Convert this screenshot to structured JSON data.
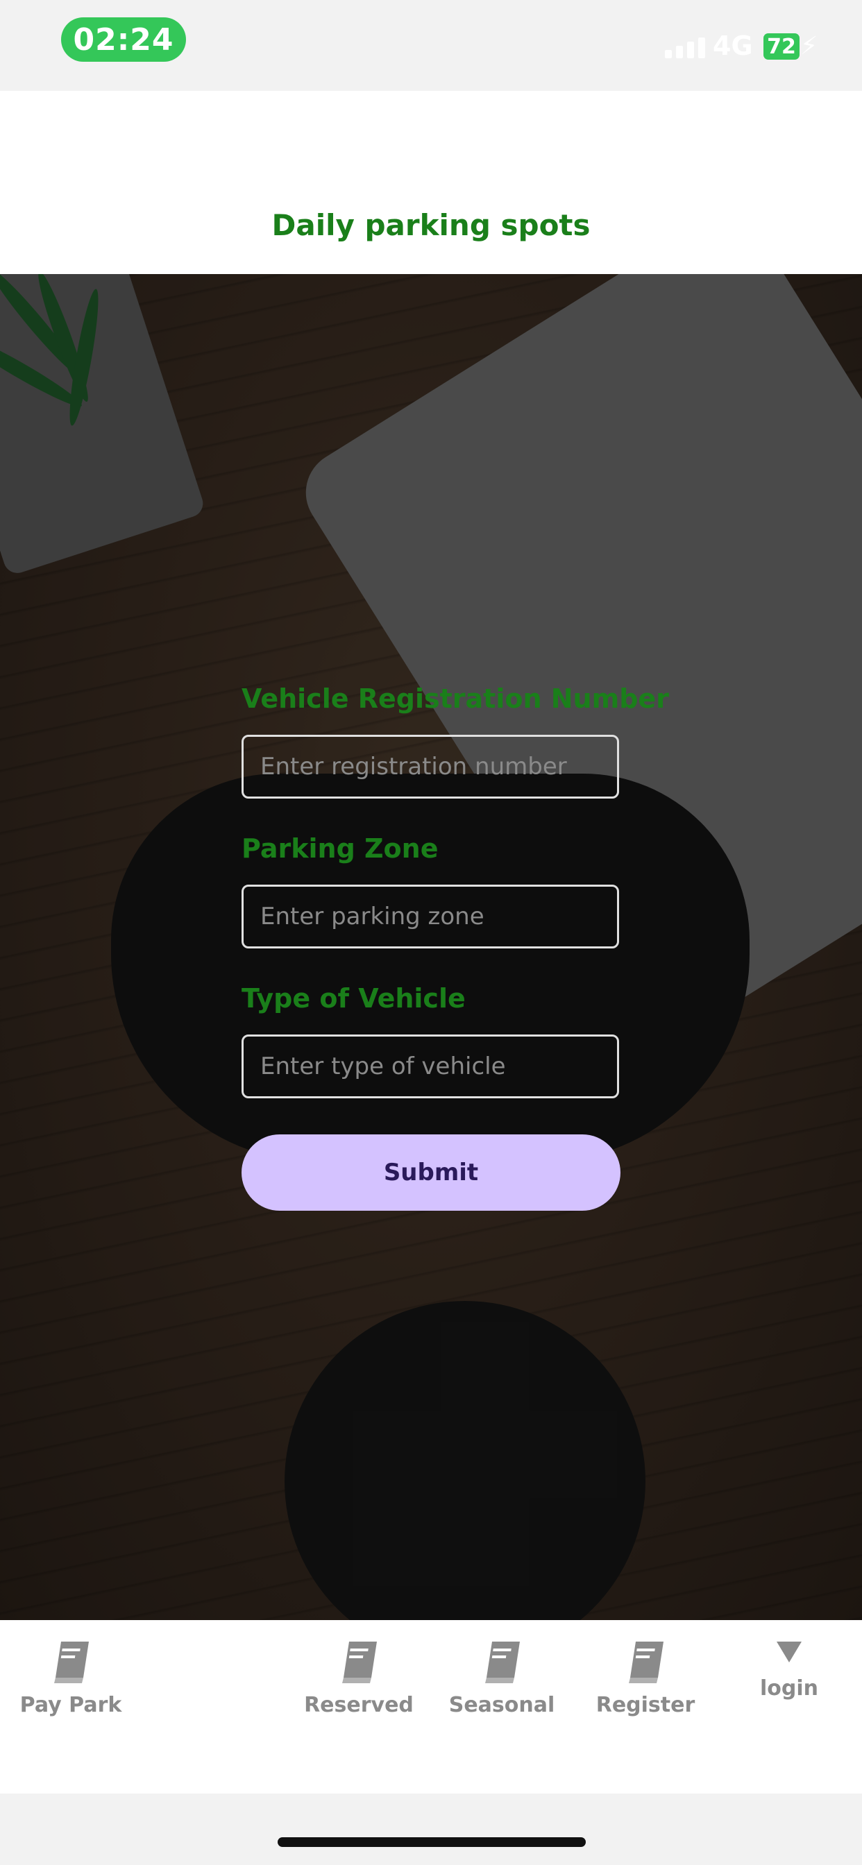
{
  "status": {
    "time": "02:24",
    "network": "4G",
    "battery": "72"
  },
  "header": {
    "title": "Daily parking spots"
  },
  "form": {
    "reg_label": "Vehicle Registration Number",
    "reg_placeholder": "Enter registration number",
    "zone_label": "Parking Zone",
    "zone_placeholder": "Enter parking zone",
    "type_label": "Type of Vehicle",
    "type_placeholder": "Enter type of vehicle",
    "submit_label": "Submit"
  },
  "tabs": [
    {
      "label": "Pay Park",
      "icon": "book-icon"
    },
    {
      "label": "Reserved",
      "icon": "book-icon"
    },
    {
      "label": "Seasonal",
      "icon": "book-icon"
    },
    {
      "label": "Register",
      "icon": "book-icon"
    },
    {
      "label": "login",
      "icon": "triangle-down-icon"
    }
  ],
  "colors": {
    "accent_green": "#1a7f1a",
    "button_bg": "#d4c2ff",
    "time_pill": "#34c759"
  }
}
